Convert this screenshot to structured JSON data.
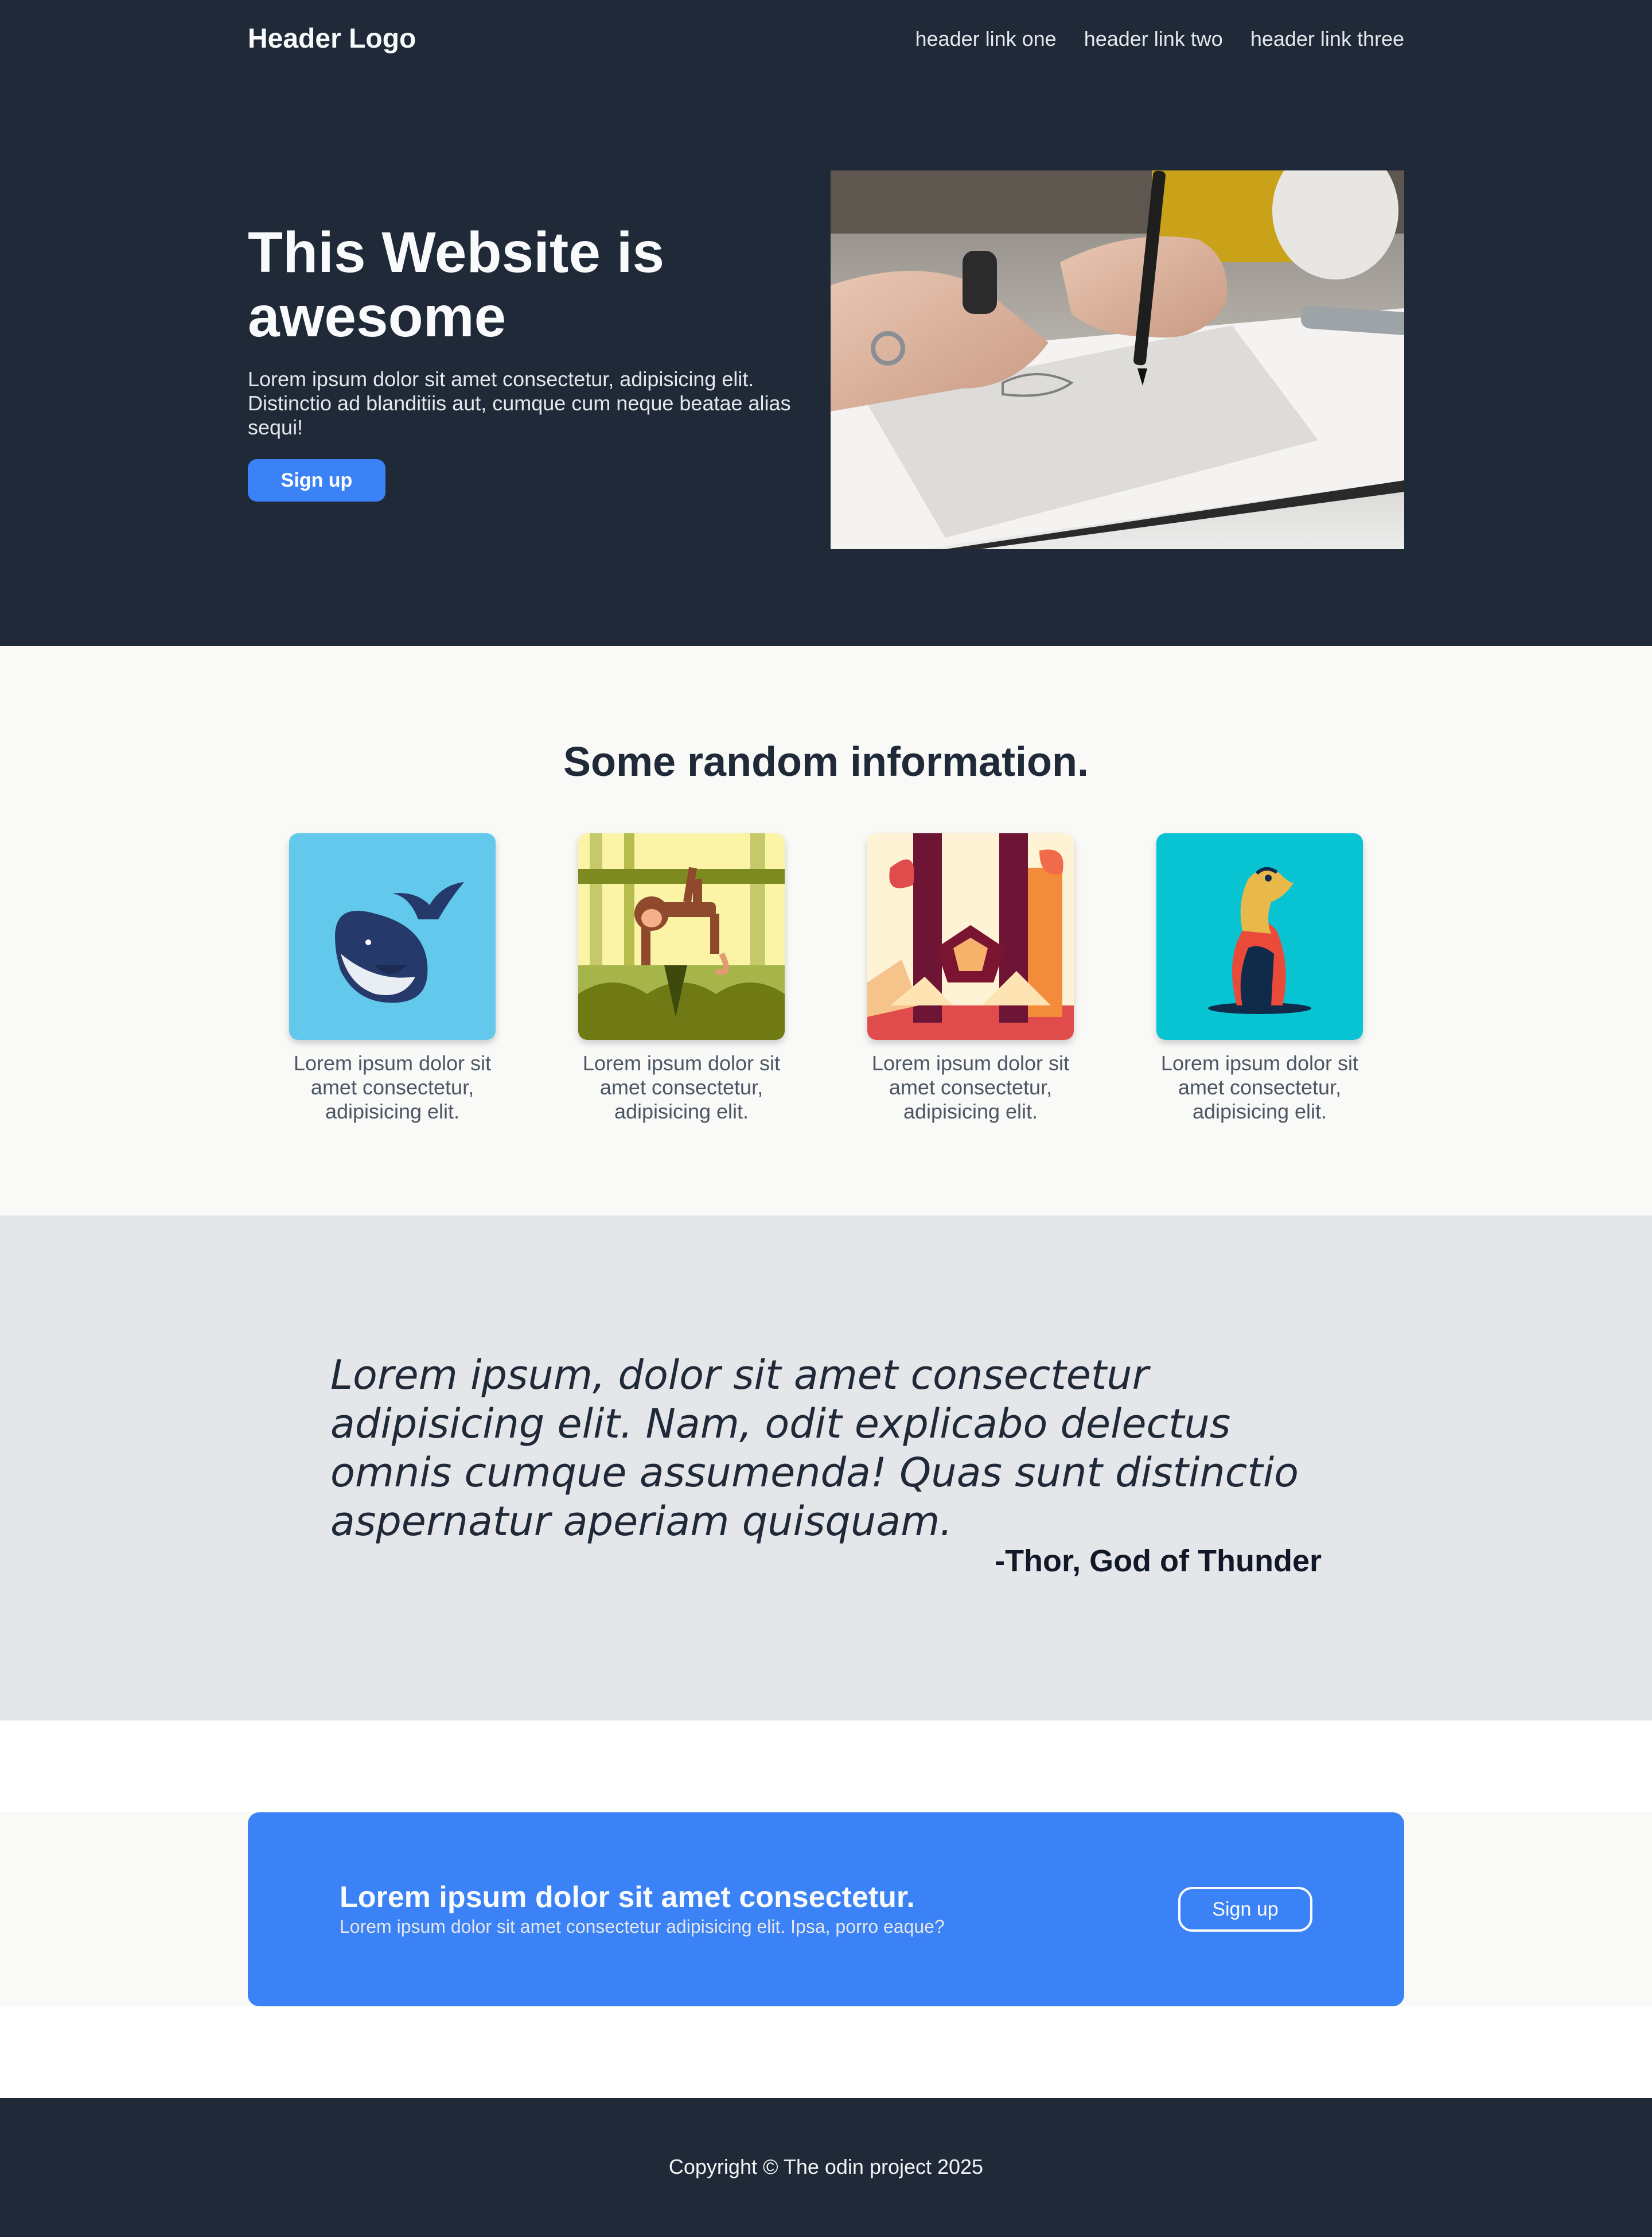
{
  "header": {
    "logo": "Header Logo",
    "links": [
      "header link one",
      "header link two",
      "header link three"
    ]
  },
  "hero": {
    "title": "This Website is awesome",
    "text": "Lorem ipsum dolor sit amet consectetur, adipisicing elit. Distinctio ad blanditiis aut, cumque cum neque beatae alias sequi!",
    "button_label": "Sign up"
  },
  "info": {
    "title": "Some random information.",
    "cards": [
      {
        "icon": "whale-illustration",
        "text": "Lorem ipsum dolor sit amet consectetur, adipisicing elit."
      },
      {
        "icon": "monkey-illustration",
        "text": "Lorem ipsum dolor sit amet consectetur, adipisicing elit."
      },
      {
        "icon": "lion-illustration",
        "text": "Lorem ipsum dolor sit amet consectetur, adipisicing elit."
      },
      {
        "icon": "meerkat-illustration",
        "text": "Lorem ipsum dolor sit amet consectetur, adipisicing elit."
      }
    ]
  },
  "quote": {
    "text": "Lorem ipsum, dolor sit amet consectetur adipisicing elit. Nam, odit explicabo delectus omnis cumque assumenda! Quas sunt distinctio aspernatur aperiam quisquam.",
    "author": "-Thor, God of Thunder"
  },
  "cta": {
    "title": "Lorem ipsum dolor sit amet consectetur.",
    "text": "Lorem ipsum dolor sit amet consectetur adipisicing elit. Ipsa, porro eaque?",
    "button_label": "Sign up"
  },
  "footer": {
    "copyright": "Copyright © The odin project 2025"
  },
  "colors": {
    "dark": "#1f2937",
    "accent": "#3b82f6",
    "light_bg": "#f9f9f7",
    "quote_bg": "#e5e6ea"
  }
}
